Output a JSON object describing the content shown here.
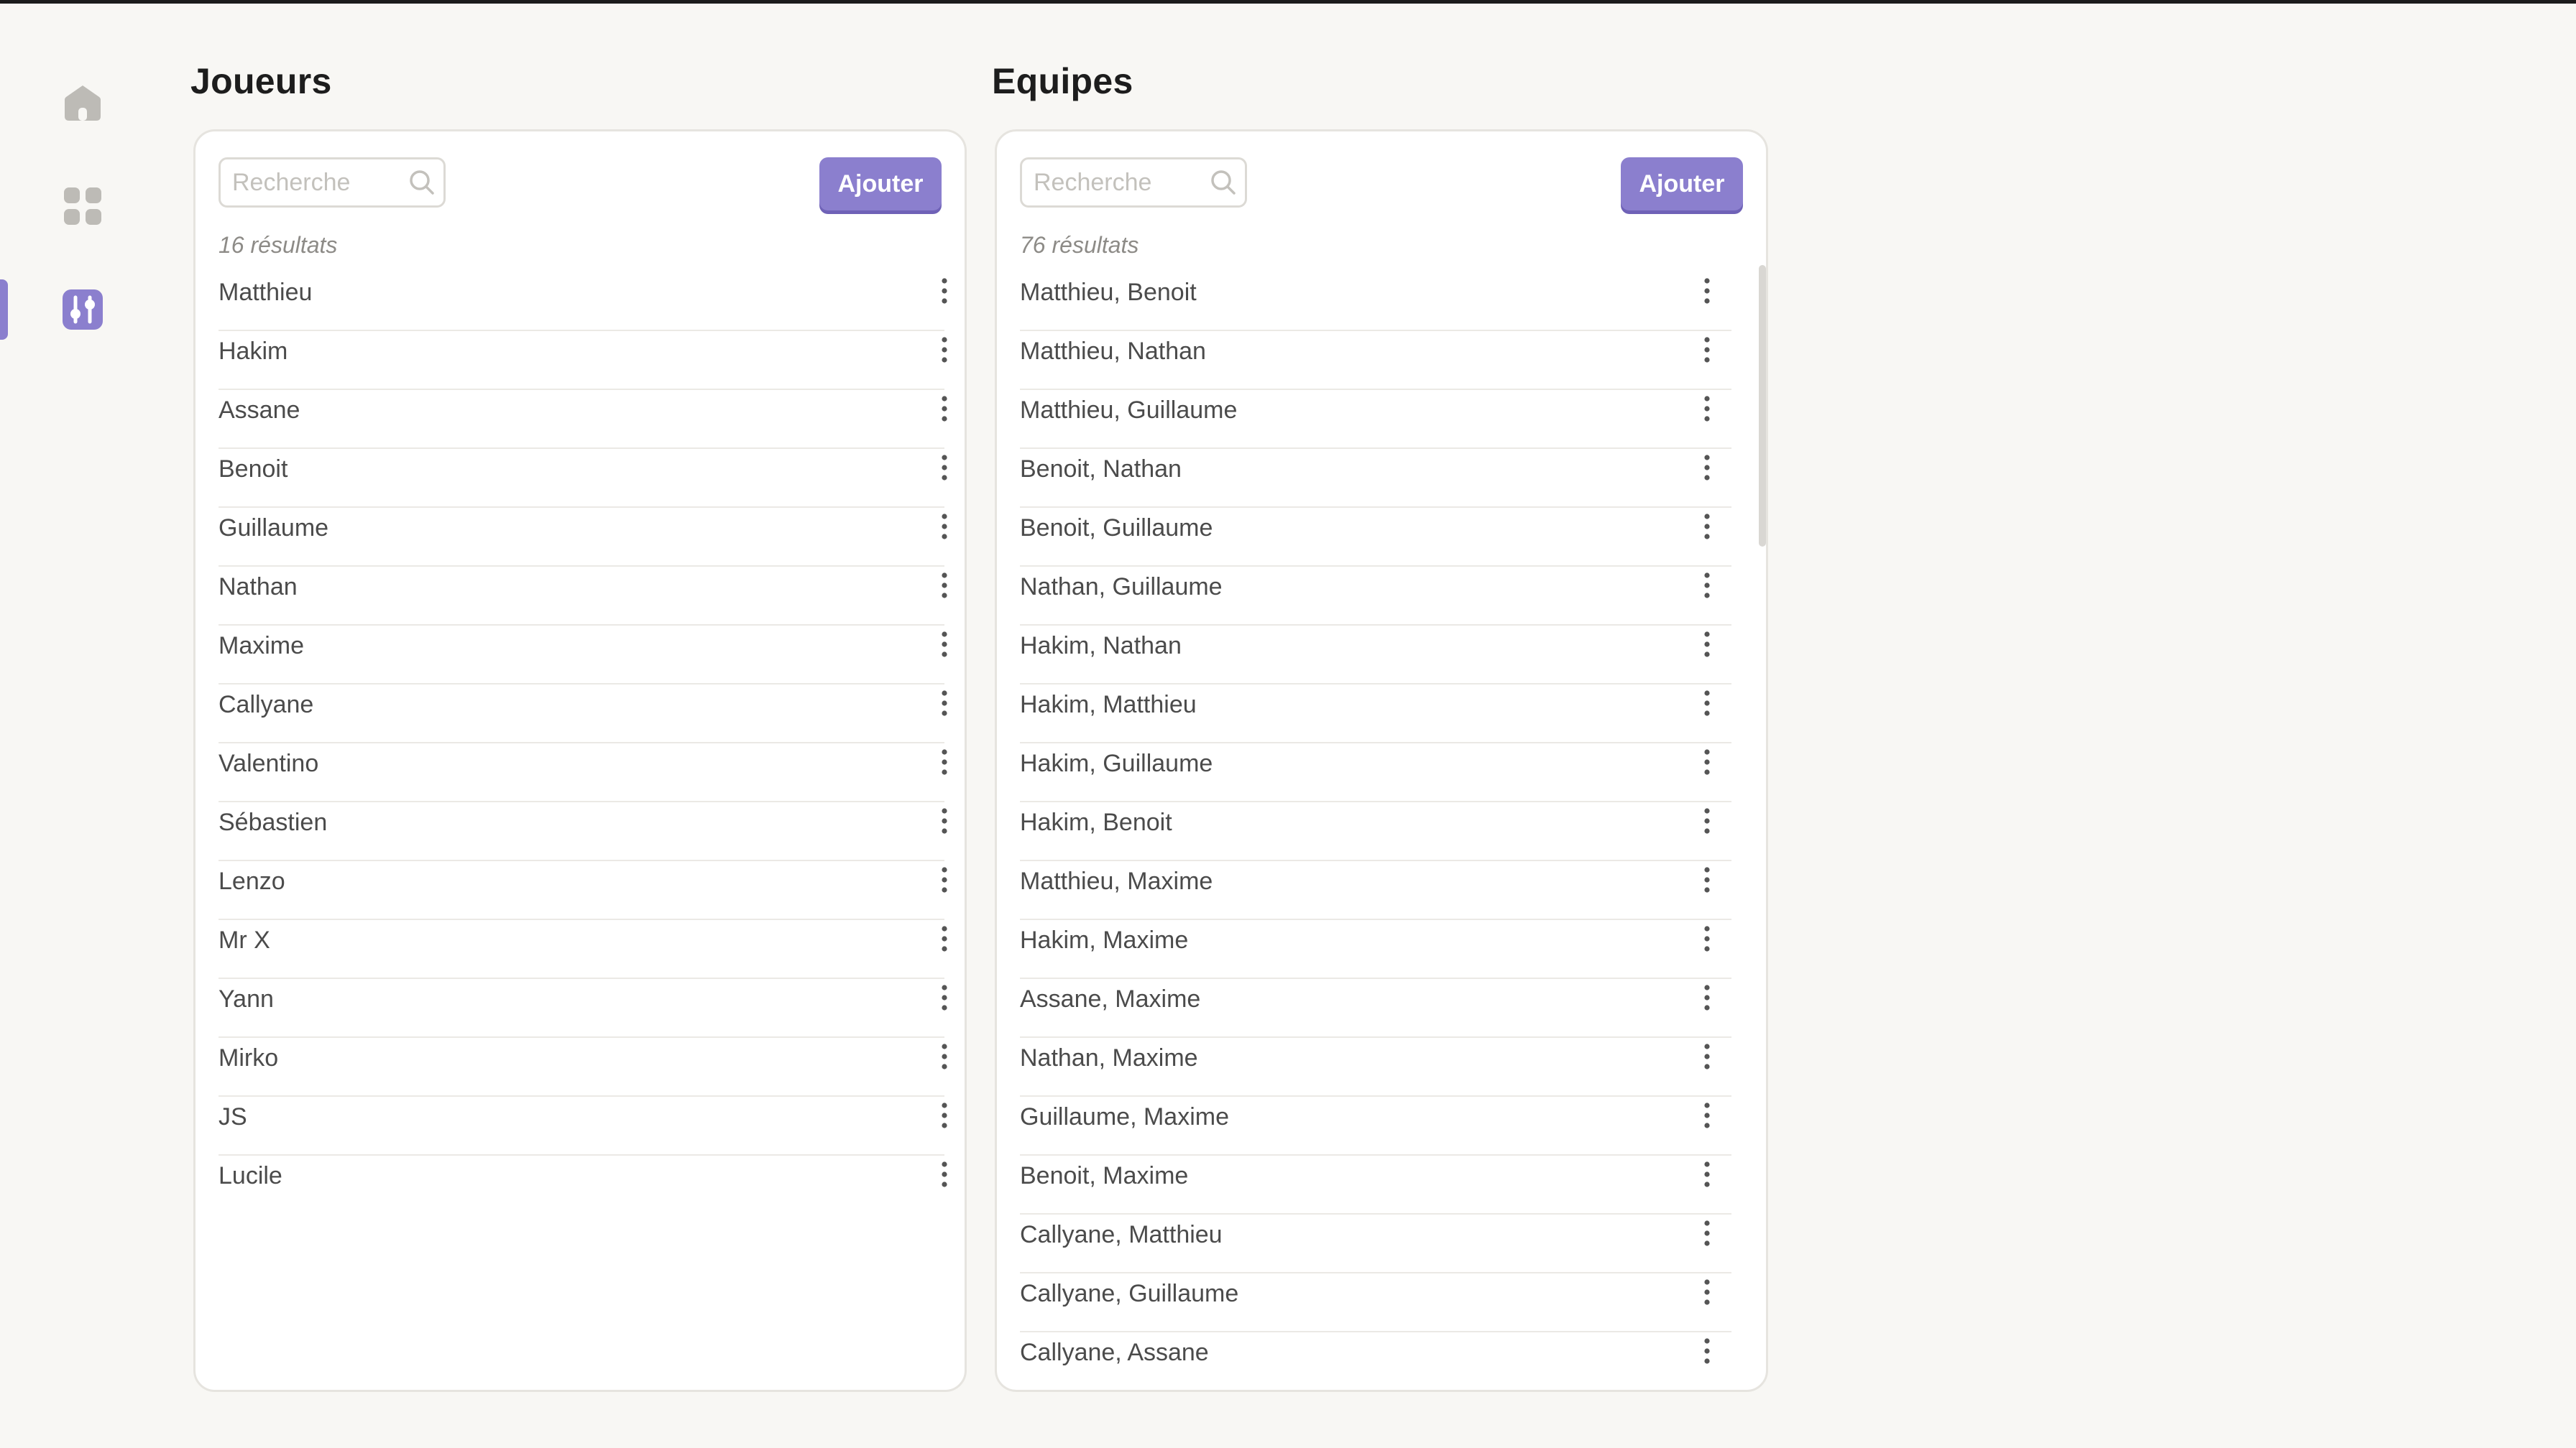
{
  "sidebar": {
    "items": [
      {
        "name": "home",
        "icon": "home-icon",
        "active": false
      },
      {
        "name": "grid",
        "icon": "grid-icon",
        "active": false
      },
      {
        "name": "settings",
        "icon": "sliders-icon",
        "active": true
      }
    ]
  },
  "players": {
    "title": "Joueurs",
    "search_placeholder": "Recherche",
    "add_label": "Ajouter",
    "count_text": "16 résultats",
    "items": [
      {
        "label": "Matthieu"
      },
      {
        "label": "Hakim"
      },
      {
        "label": "Assane"
      },
      {
        "label": "Benoit"
      },
      {
        "label": "Guillaume"
      },
      {
        "label": "Nathan"
      },
      {
        "label": "Maxime"
      },
      {
        "label": "Callyane"
      },
      {
        "label": "Valentino"
      },
      {
        "label": "Sébastien"
      },
      {
        "label": "Lenzo"
      },
      {
        "label": "Mr X"
      },
      {
        "label": "Yann"
      },
      {
        "label": "Mirko"
      },
      {
        "label": "JS"
      },
      {
        "label": "Lucile"
      }
    ]
  },
  "teams": {
    "title": "Equipes",
    "search_placeholder": "Recherche",
    "add_label": "Ajouter",
    "count_text": "76 résultats",
    "items": [
      {
        "label": "Matthieu, Benoit"
      },
      {
        "label": "Matthieu, Nathan"
      },
      {
        "label": "Matthieu, Guillaume"
      },
      {
        "label": "Benoit, Nathan"
      },
      {
        "label": "Benoit, Guillaume"
      },
      {
        "label": "Nathan, Guillaume"
      },
      {
        "label": "Hakim, Nathan"
      },
      {
        "label": "Hakim, Matthieu"
      },
      {
        "label": "Hakim, Guillaume"
      },
      {
        "label": "Hakim, Benoit"
      },
      {
        "label": "Matthieu, Maxime"
      },
      {
        "label": "Hakim, Maxime"
      },
      {
        "label": "Assane, Maxime"
      },
      {
        "label": "Nathan, Maxime"
      },
      {
        "label": "Guillaume, Maxime"
      },
      {
        "label": "Benoit, Maxime"
      },
      {
        "label": "Callyane, Matthieu"
      },
      {
        "label": "Callyane, Guillaume"
      },
      {
        "label": "Callyane, Assane"
      }
    ]
  },
  "colors": {
    "accent": "#8b7fce",
    "accent_shadow": "#6f62b7",
    "background": "#f8f7f4",
    "card": "#ffffff",
    "icon_inactive": "#bdbbb6",
    "title": "#1d1d1d",
    "text": "#4b4b4b",
    "muted": "#8d8b87"
  }
}
